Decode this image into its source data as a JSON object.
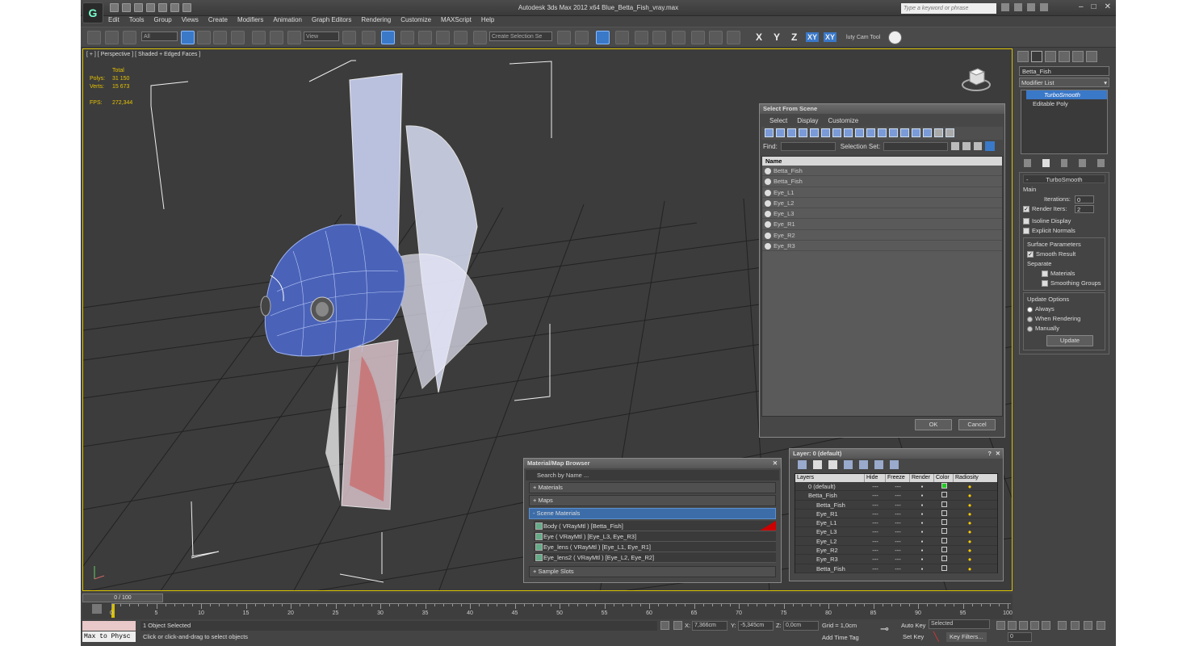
{
  "app": {
    "title": "Autodesk 3ds Max  2012 x64     Blue_Betta_Fish_vray.max",
    "search_placeholder": "Type a keyword or phrase"
  },
  "menu": [
    "Edit",
    "Tools",
    "Group",
    "Views",
    "Create",
    "Modifiers",
    "Animation",
    "Graph Editors",
    "Rendering",
    "Customize",
    "MAXScript",
    "Help"
  ],
  "toolbar": {
    "filter": "All",
    "refcoord": "View",
    "selset": "Create Selection Se",
    "axes": [
      "X",
      "Y",
      "Z",
      "XY",
      "XY"
    ],
    "camtool": "luty Cam Tool"
  },
  "viewport": {
    "label": "[ + ] [ Perspective ] [ Shaded + Edged Faces ]",
    "total": "Total",
    "polys_label": "Polys:",
    "polys": "31 150",
    "verts_label": "Verts:",
    "verts": "15 673",
    "fps_label": "FPS:",
    "fps": "272,344"
  },
  "select_dialog": {
    "title": "Select From Scene",
    "menu": [
      "Select",
      "Display",
      "Customize"
    ],
    "find": "Find:",
    "selset": "Selection Set:",
    "col": "Name",
    "items": [
      "Betta_Fish",
      "Betta_Fish",
      "Eye_L1",
      "Eye_L2",
      "Eye_L3",
      "Eye_R1",
      "Eye_R2",
      "Eye_R3"
    ],
    "ok": "OK",
    "cancel": "Cancel"
  },
  "material_browser": {
    "title": "Material/Map Browser",
    "search": "Search by Name ...",
    "materials": "+ Materials",
    "maps": "+ Maps",
    "scene": "- Scene Materials",
    "items": [
      "Body  ( VRayMtl )  [Betta_Fish]",
      "Eye  ( VRayMtl )  [Eye_L3, Eye_R3]",
      "Eye_lens  ( VRayMtl )  [Eye_L1, Eye_R1]",
      "Eye_lens2  ( VRayMtl )  [Eye_L2, Eye_R2]"
    ],
    "sample": "+ Sample Slots"
  },
  "layer_dialog": {
    "title": "Layer: 0 (default)",
    "help": "?",
    "cols": [
      "Layers",
      "Hide",
      "Freeze",
      "Render",
      "Color",
      "Radiosity"
    ],
    "rows": [
      "0 (default)",
      "Betta_Fish",
      "Betta_Fish",
      "Eye_R1",
      "Eye_L1",
      "Eye_L3",
      "Eye_L2",
      "Eye_R2",
      "Eye_R3",
      "Betta_Fish"
    ]
  },
  "command_panel": {
    "object": "Betta_Fish",
    "modlist": "Modifier List",
    "stack": [
      "TurboSmooth",
      "Editable Poly"
    ],
    "rollout": "TurboSmooth",
    "main": "Main",
    "iter_label": "Iterations:",
    "iter": "0",
    "render_label": "Render Iters:",
    "render": "2",
    "isoline": "Isoline Display",
    "explicit": "Explicit Normals",
    "surface": "Surface Parameters",
    "smooth": "Smooth Result",
    "separate": "Separate",
    "materials": "Materials",
    "smoothing": "Smoothing Groups",
    "update_opts": "Update Options",
    "always": "Always",
    "when_rendering": "When Rendering",
    "manually": "Manually",
    "update": "Update"
  },
  "timeline": {
    "frame": "0 / 100",
    "ticks": [
      "0",
      "5",
      "10",
      "15",
      "20",
      "25",
      "30",
      "35",
      "40",
      "45",
      "50",
      "55",
      "60",
      "65",
      "70",
      "75",
      "80",
      "85",
      "90",
      "95",
      "100"
    ]
  },
  "status": {
    "maxscript": "Max to Physc",
    "selected": "1 Object Selected",
    "prompt": "Click or click-and-drag to select objects",
    "x_label": "X:",
    "x": "7,366cm",
    "y_label": "Y:",
    "y": "-5,345cm",
    "z_label": "Z:",
    "z": "0,0cm",
    "grid": "Grid = 1,0cm",
    "autokey": "Auto Key",
    "selected_dd": "Selected",
    "setkey": "Set Key",
    "keyfilters": "Key Filters...",
    "addtime": "Add Time Tag",
    "frame_no": "0"
  }
}
